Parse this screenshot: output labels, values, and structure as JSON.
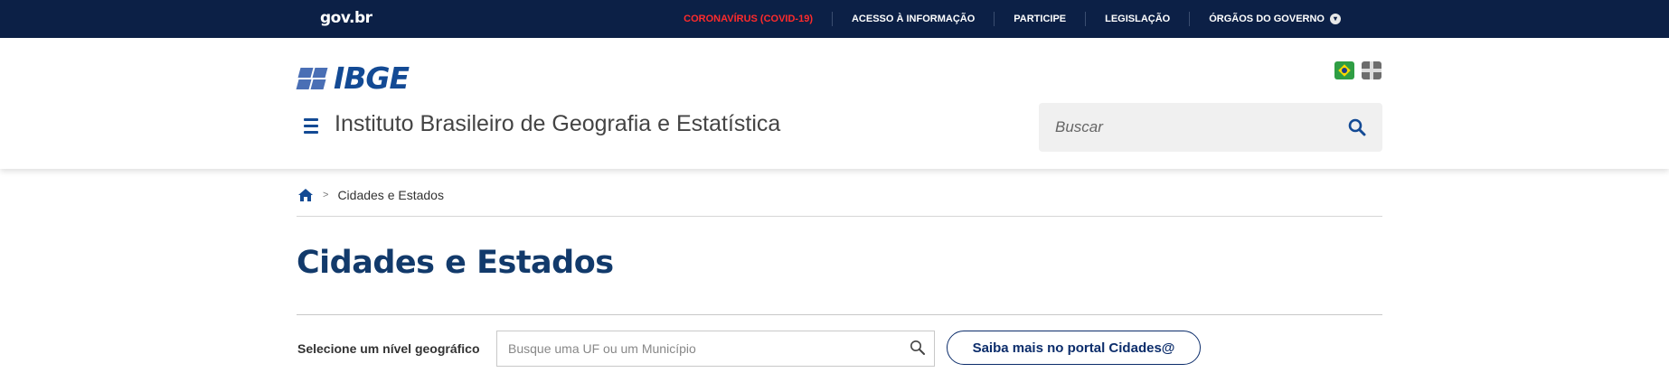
{
  "gov_bar": {
    "brand": "gov.br",
    "links": [
      "CORONAVÍRUS (COVID-19)",
      "ACESSO À INFORMAÇÃO",
      "PARTICIPE",
      "LEGISLAÇÃO",
      "ÓRGÃOS DO GOVERNO"
    ]
  },
  "header": {
    "logo_text": "IBGE",
    "site_title": "Instituto Brasileiro de Geografia e Estatística",
    "search_placeholder": "Buscar",
    "flags": [
      "brazil-flag-icon",
      "uk-flag-icon"
    ]
  },
  "breadcrumb": {
    "current": "Cidades e Estados"
  },
  "page_title": "Cidades e Estados",
  "geo_select": {
    "label": "Selecione um nível geográfico",
    "placeholder": "Busque uma UF ou um Município"
  },
  "portal_button": "Saiba mais no portal Cidades@",
  "colors": {
    "gov_bar": "#0c2046",
    "covid_link": "#ff2b2b",
    "brand_blue": "#134a94",
    "title_blue": "#123a6b"
  }
}
